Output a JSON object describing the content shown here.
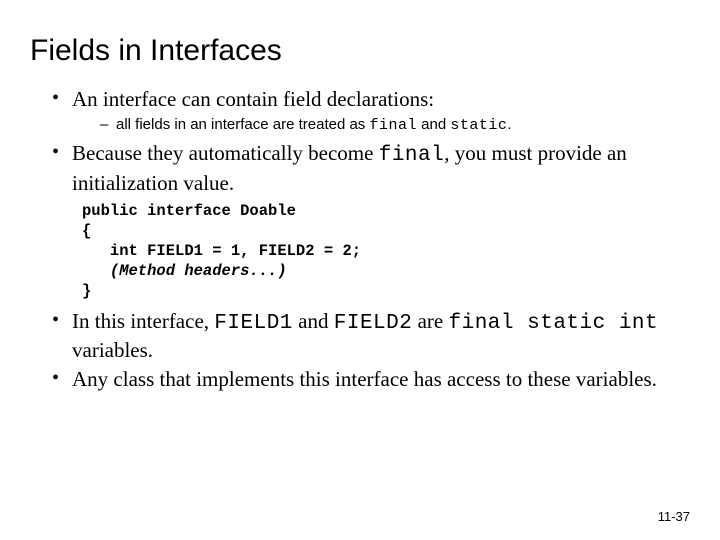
{
  "title": "Fields in Interfaces",
  "bullets": {
    "b1": "An interface can contain field declarations:",
    "b1_sub": "all fields in an interface are treated as ",
    "b1_sub_code1": "final",
    "b1_sub_mid": " and ",
    "b1_sub_code2": "static",
    "b1_sub_end": ".",
    "b2a": "Because they automatically become ",
    "b2_code": "final",
    "b2b": ", you must provide an initialization value.",
    "b3a": "In this interface, ",
    "b3_code1": "FIELD1",
    "b3_mid1": " and ",
    "b3_code2": "FIELD2",
    "b3_mid2": " are ",
    "b3_code3": "final static int",
    "b3b": " variables.",
    "b4": "Any class that implements this interface has access to these variables."
  },
  "code": {
    "l1": "public interface Doable",
    "l2": "{",
    "l3": "   int FIELD1 = 1, FIELD2 = 2;",
    "l4": "   (Method headers...)",
    "l5": "}"
  },
  "pagenum": "11-37"
}
